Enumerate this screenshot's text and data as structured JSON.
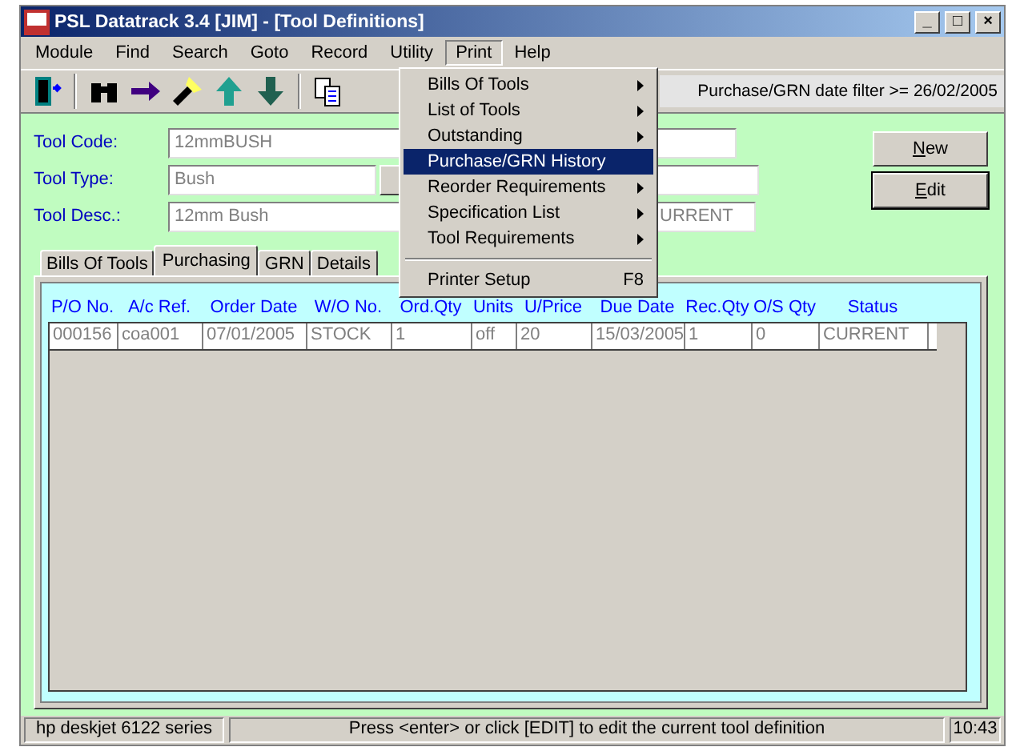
{
  "window": {
    "title": "PSL Datatrack 3.4 [JIM] - [Tool Definitions]",
    "controls": [
      "_",
      "□",
      "×"
    ]
  },
  "menu_bar": [
    {
      "label": "Module",
      "selected": false
    },
    {
      "label": "Find",
      "selected": false
    },
    {
      "label": "Search",
      "selected": false
    },
    {
      "label": "Goto",
      "selected": false
    },
    {
      "label": "Record",
      "selected": false
    },
    {
      "label": "Utility",
      "selected": false
    },
    {
      "label": "Print",
      "selected": true
    },
    {
      "label": "Help",
      "selected": false
    }
  ],
  "print_menu": [
    {
      "kind": "item",
      "label": "Bills Of Tools",
      "submenu": true,
      "selected": false
    },
    {
      "kind": "item",
      "label": "List of Tools",
      "submenu": true,
      "selected": false
    },
    {
      "kind": "item",
      "label": "Outstanding",
      "submenu": true,
      "selected": false
    },
    {
      "kind": "item",
      "label": "Purchase/GRN History",
      "submenu": false,
      "selected": true
    },
    {
      "kind": "item",
      "label": "Reorder Requirements",
      "submenu": true,
      "selected": false
    },
    {
      "kind": "item",
      "label": "Specification List",
      "submenu": true,
      "selected": false
    },
    {
      "kind": "item",
      "label": "Tool Requirements",
      "submenu": true,
      "selected": false
    },
    {
      "kind": "separator"
    },
    {
      "kind": "item",
      "label": "Printer Setup",
      "shortcut": "F8",
      "submenu": false,
      "selected": false
    }
  ],
  "filter_status": "Purchase/GRN date filter >= 26/02/2005",
  "fields": [
    {
      "label": "Tool Code:",
      "value": "12mmBUSH"
    },
    {
      "label": "Tool Type:",
      "value": "Bush"
    },
    {
      "label": "Tool Desc.:",
      "value": "12mm Bush"
    }
  ],
  "status_field": "URRENT",
  "buttons": [
    {
      "label": "New",
      "focused": false
    },
    {
      "label": "Edit",
      "focused": true
    }
  ],
  "tabs": [
    {
      "label": "Bills Of Tools",
      "selected": false
    },
    {
      "label": "Purchasing",
      "selected": true
    },
    {
      "label": "GRN",
      "selected": false
    },
    {
      "label": "Details",
      "selected": false
    }
  ],
  "table": {
    "columns": [
      "P/O No.",
      "A/c Ref.",
      "Order Date",
      "W/O No.",
      "Ord.Qty",
      "Units",
      "U/Price",
      "Due Date",
      "Rec.Qty",
      "O/S Qty",
      "Status"
    ],
    "rows": [
      [
        "000156",
        "coa001",
        "07/01/2005",
        "STOCK",
        "1",
        "off",
        "20",
        "15/03/2005",
        "1",
        "0",
        "CURRENT"
      ]
    ]
  },
  "status_bar": [
    "hp deskjet 6122 series",
    "Press <enter> or click [EDIT] to edit the current tool definition",
    "10:43"
  ]
}
